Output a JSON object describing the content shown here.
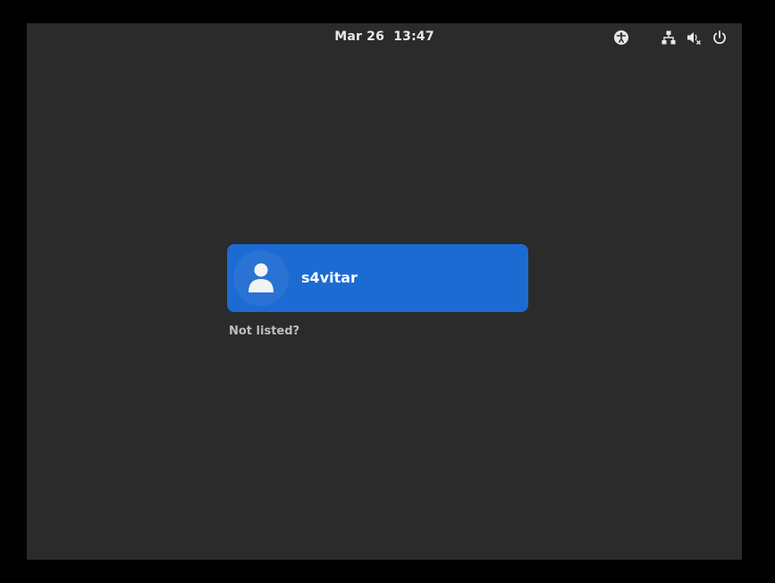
{
  "topbar": {
    "date": "Mar 26",
    "time": "13:47",
    "icons": [
      "accessibility-icon",
      "network-icon",
      "volume-muted-icon",
      "power-icon"
    ]
  },
  "login": {
    "user": {
      "name": "s4vitar",
      "avatar_icon": "user-avatar-icon"
    },
    "not_listed_label": "Not listed?"
  },
  "colors": {
    "background": "#2b2b2b",
    "outer": "#000000",
    "accent": "#1c6bd3",
    "text": "#ffffff",
    "muted_text": "#bdbdbd"
  }
}
